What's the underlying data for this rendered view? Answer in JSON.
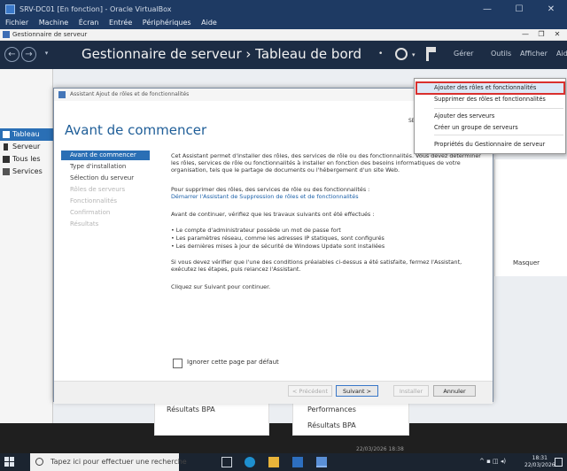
{
  "vbox": {
    "title": "SRV-DC01 [En fonction] - Oracle VirtualBox",
    "menu": [
      "Fichier",
      "Machine",
      "Écran",
      "Entrée",
      "Périphériques",
      "Aide"
    ]
  },
  "server_manager": {
    "window_title": "Gestionnaire de serveur",
    "heading": "Gestionnaire de serveur  ›  Tableau de bord",
    "header_menus": [
      "Gérer",
      "Outils",
      "Afficher",
      "Aide"
    ],
    "nav": [
      {
        "label": "Tableau",
        "selected": true,
        "icon": "dashboard-icon"
      },
      {
        "label": "Serveur",
        "selected": false,
        "icon": "server-icon"
      },
      {
        "label": "Tous les",
        "selected": false,
        "icon": "servers-icon"
      },
      {
        "label": "Services",
        "selected": false,
        "icon": "file-services-icon"
      }
    ],
    "tiles": {
      "bpa_left": "Résultats BPA",
      "performances": "Performances",
      "bpa_right": "Résultats BPA",
      "masquer": "Masquer",
      "date": "22/03/2026 18:38"
    }
  },
  "dropdown": {
    "items": [
      "Ajouter des rôles et fonctionnalités",
      "Supprimer des rôles et fonctionnalités",
      "Ajouter des serveurs",
      "Créer un groupe de serveurs",
      "Propriétés du Gestionnaire de serveur"
    ],
    "highlight_color": "#d9302e"
  },
  "wizard": {
    "title": "Assistant Ajout de rôles et de fonctionnalités",
    "heading": "Avant de commencer",
    "dest": "SE",
    "steps": [
      {
        "label": "Avant de commencer",
        "state": "active"
      },
      {
        "label": "Type d'installation",
        "state": "normal"
      },
      {
        "label": "Sélection du serveur",
        "state": "normal"
      },
      {
        "label": "Rôles de serveurs",
        "state": "disabled"
      },
      {
        "label": "Fonctionnalités",
        "state": "disabled"
      },
      {
        "label": "Confirmation",
        "state": "disabled"
      },
      {
        "label": "Résultats",
        "state": "disabled"
      }
    ],
    "p1": "Cet Assistant permet d'installer des rôles, des services de rôle ou des fonctionnalités. Vous devez déterminer les rôles, services de rôle ou fonctionnalités à installer en fonction des besoins informatiques de votre organisation, tels que le partage de documents ou l'hébergement d'un site Web.",
    "p2": "Pour supprimer des rôles, des services de rôle ou des fonctionnalités :",
    "link": "Démarrer l'Assistant de Suppression de rôles et de fonctionnalités",
    "p3": "Avant de continuer, vérifiez que les travaux suivants ont été effectués :",
    "bullets": [
      "• Le compte d'administrateur possède un mot de passe fort",
      "• Les paramètres réseau, comme les adresses IP statiques, sont configurés",
      "• Les dernières mises à jour de sécurité de Windows Update sont installées"
    ],
    "p4": "Si vous devez vérifier que l'une des conditions préalables ci-dessus a été satisfaite, fermez l'Assistant, exécutez les étapes, puis relancez l'Assistant.",
    "p5": "Cliquez sur Suivant pour continuer.",
    "checkbox_label": "Ignorer cette page par défaut",
    "buttons": {
      "prev": "< Précédent",
      "next": "Suivant >",
      "install": "Installer",
      "cancel": "Annuler"
    }
  },
  "taskbar": {
    "search_placeholder": "Tapez ici pour effectuer une recherche",
    "time": "18:31",
    "date": "22/03/2026"
  },
  "colors": {
    "accent": "#2a6fb5",
    "header": "#1c2c44",
    "vbox_title": "#1e3a63"
  }
}
